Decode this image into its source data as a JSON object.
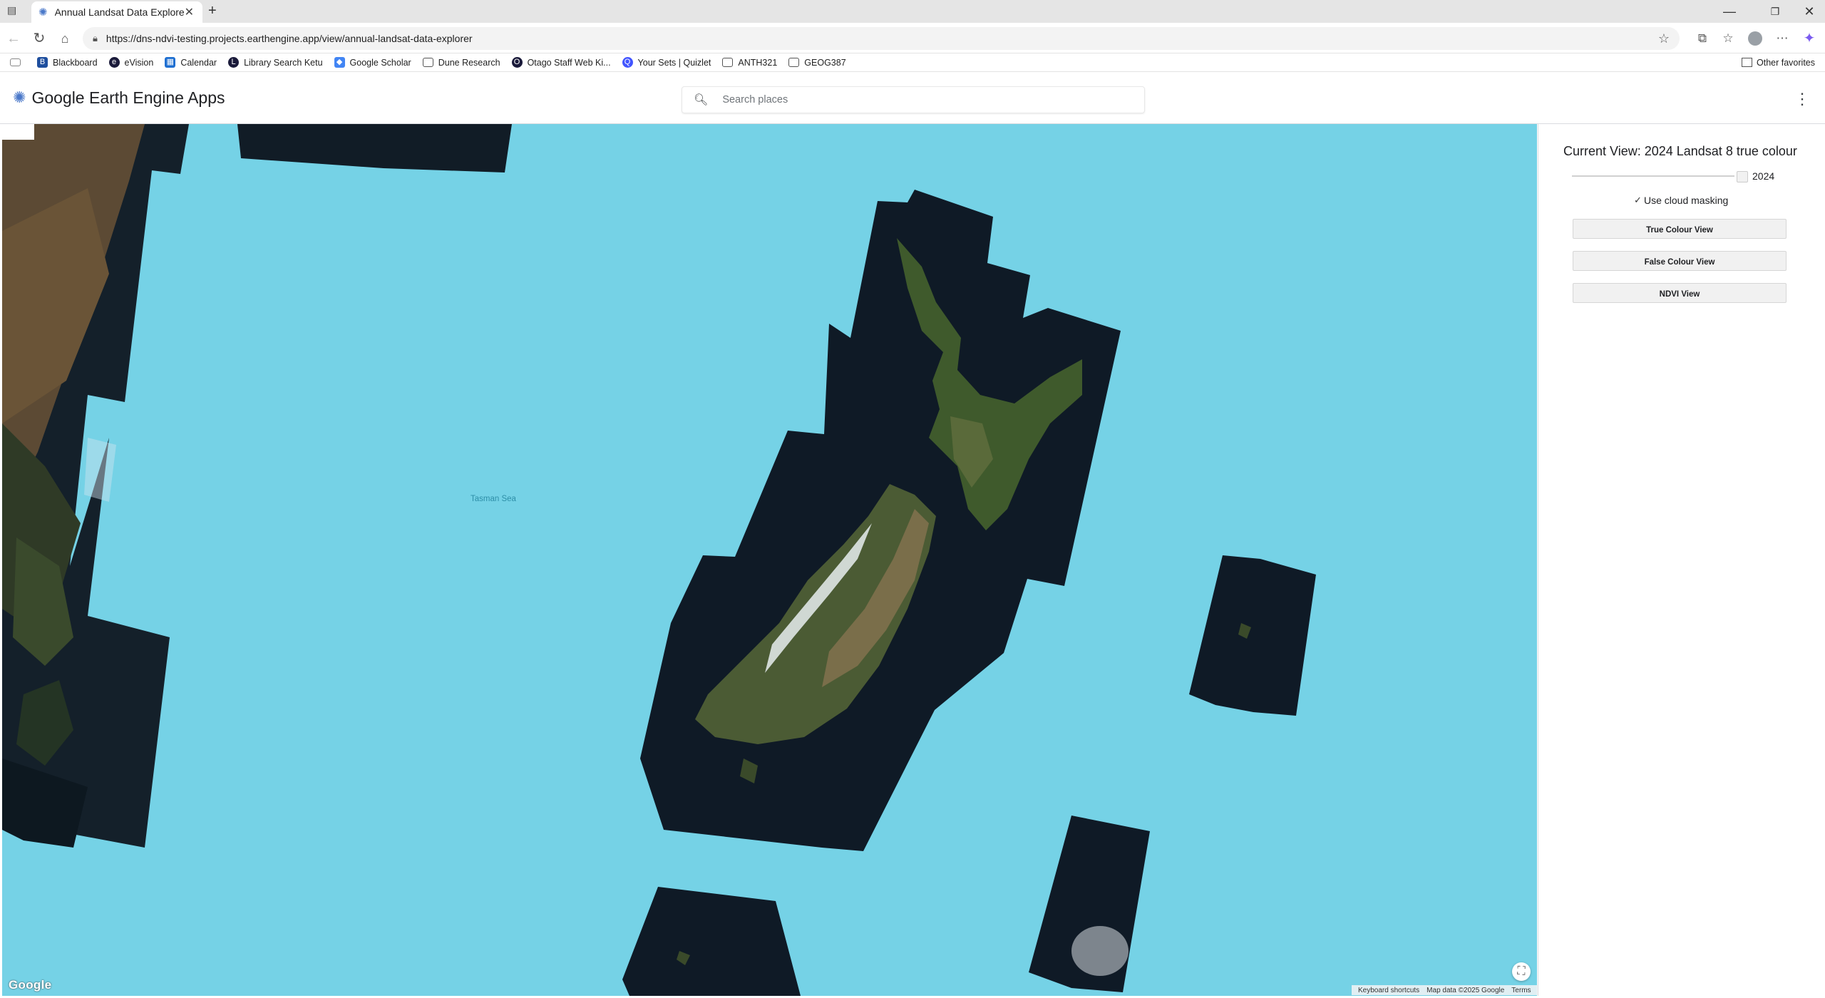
{
  "browser": {
    "tab_title": "Annual Landsat Data Explorer",
    "url": "https://dns-ndvi-testing.projects.earthengine.app/view/annual-landsat-data-explorer",
    "bookmarks": [
      {
        "label": "Blackboard",
        "icon": "blackboard-icon",
        "color": "#1f4f9e"
      },
      {
        "label": "eVision",
        "icon": "evision-icon",
        "color": "#1a1a3a"
      },
      {
        "label": "Calendar",
        "icon": "calendar-icon",
        "color": "#1f6fd1"
      },
      {
        "label": "Library Search Ketu",
        "icon": "library-icon",
        "color": "#1a1a3a"
      },
      {
        "label": "Google Scholar",
        "icon": "scholar-icon",
        "color": "#4285f4"
      },
      {
        "label": "Dune Research",
        "icon": "folder-icon",
        "color": "#555555"
      },
      {
        "label": "Otago Staff Web Ki...",
        "icon": "otago-icon",
        "color": "#1a1a3a"
      },
      {
        "label": "Your Sets | Quizlet",
        "icon": "quizlet-icon",
        "color": "#4255ff"
      },
      {
        "label": "ANTH321",
        "icon": "folder-icon",
        "color": "#555555"
      },
      {
        "label": "GEOG387",
        "icon": "folder-icon",
        "color": "#555555"
      }
    ],
    "other_favorites": "Other favorites"
  },
  "app": {
    "title": "Google Earth Engine Apps",
    "search_placeholder": "Search places"
  },
  "map": {
    "sea_label": "Tasman Sea",
    "logo": "Google",
    "attribution": [
      "Keyboard shortcuts",
      "Map data ©2025 Google",
      "Terms"
    ],
    "water_color": "#75d2e6"
  },
  "panel": {
    "title": "Current View: 2024 Landsat 8 true colour",
    "year_value": "2024",
    "cloud_masking_label": "Use cloud masking",
    "cloud_masking_checked": true,
    "buttons": [
      "True Colour View",
      "False Colour View",
      "NDVI View"
    ]
  }
}
